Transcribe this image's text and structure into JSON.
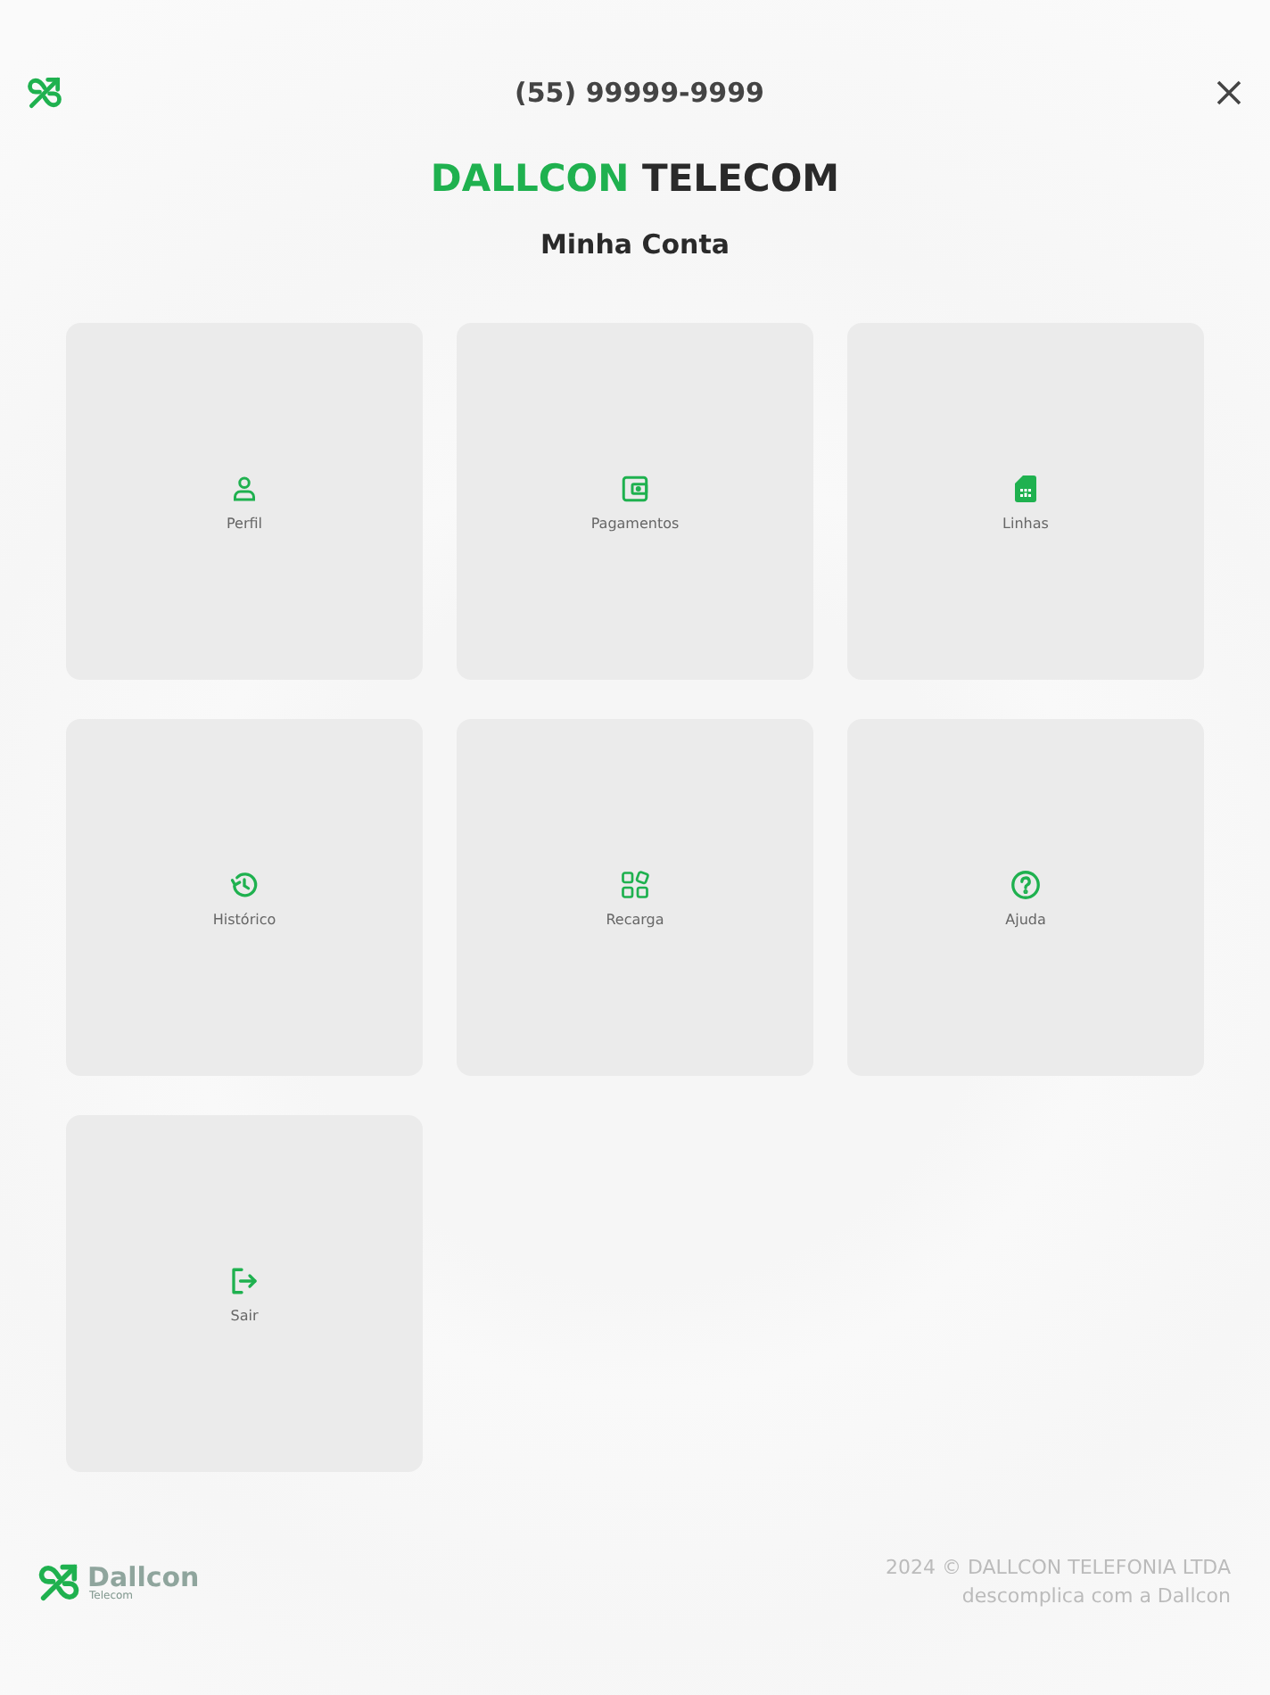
{
  "header": {
    "phone": "(55) 99999-9999"
  },
  "brand": {
    "highlight": "DALLCON",
    "rest": "TELECOM"
  },
  "page_title": "Minha Conta",
  "menu": [
    {
      "kind": "profile",
      "label": "Perfil"
    },
    {
      "kind": "wallet",
      "label": "Pagamentos"
    },
    {
      "kind": "sim",
      "label": "Linhas"
    },
    {
      "kind": "history",
      "label": "Histórico"
    },
    {
      "kind": "apps",
      "label": "Recarga"
    },
    {
      "kind": "help",
      "label": "Ajuda"
    },
    {
      "kind": "logout",
      "label": "Sair"
    }
  ],
  "footer": {
    "logo_name": "Dallcon",
    "logo_tagline": "Telecom",
    "copyright": "2024 © DALLCON TELEFONIA LTDA",
    "slogan": "descomplica com a Dallcon"
  }
}
